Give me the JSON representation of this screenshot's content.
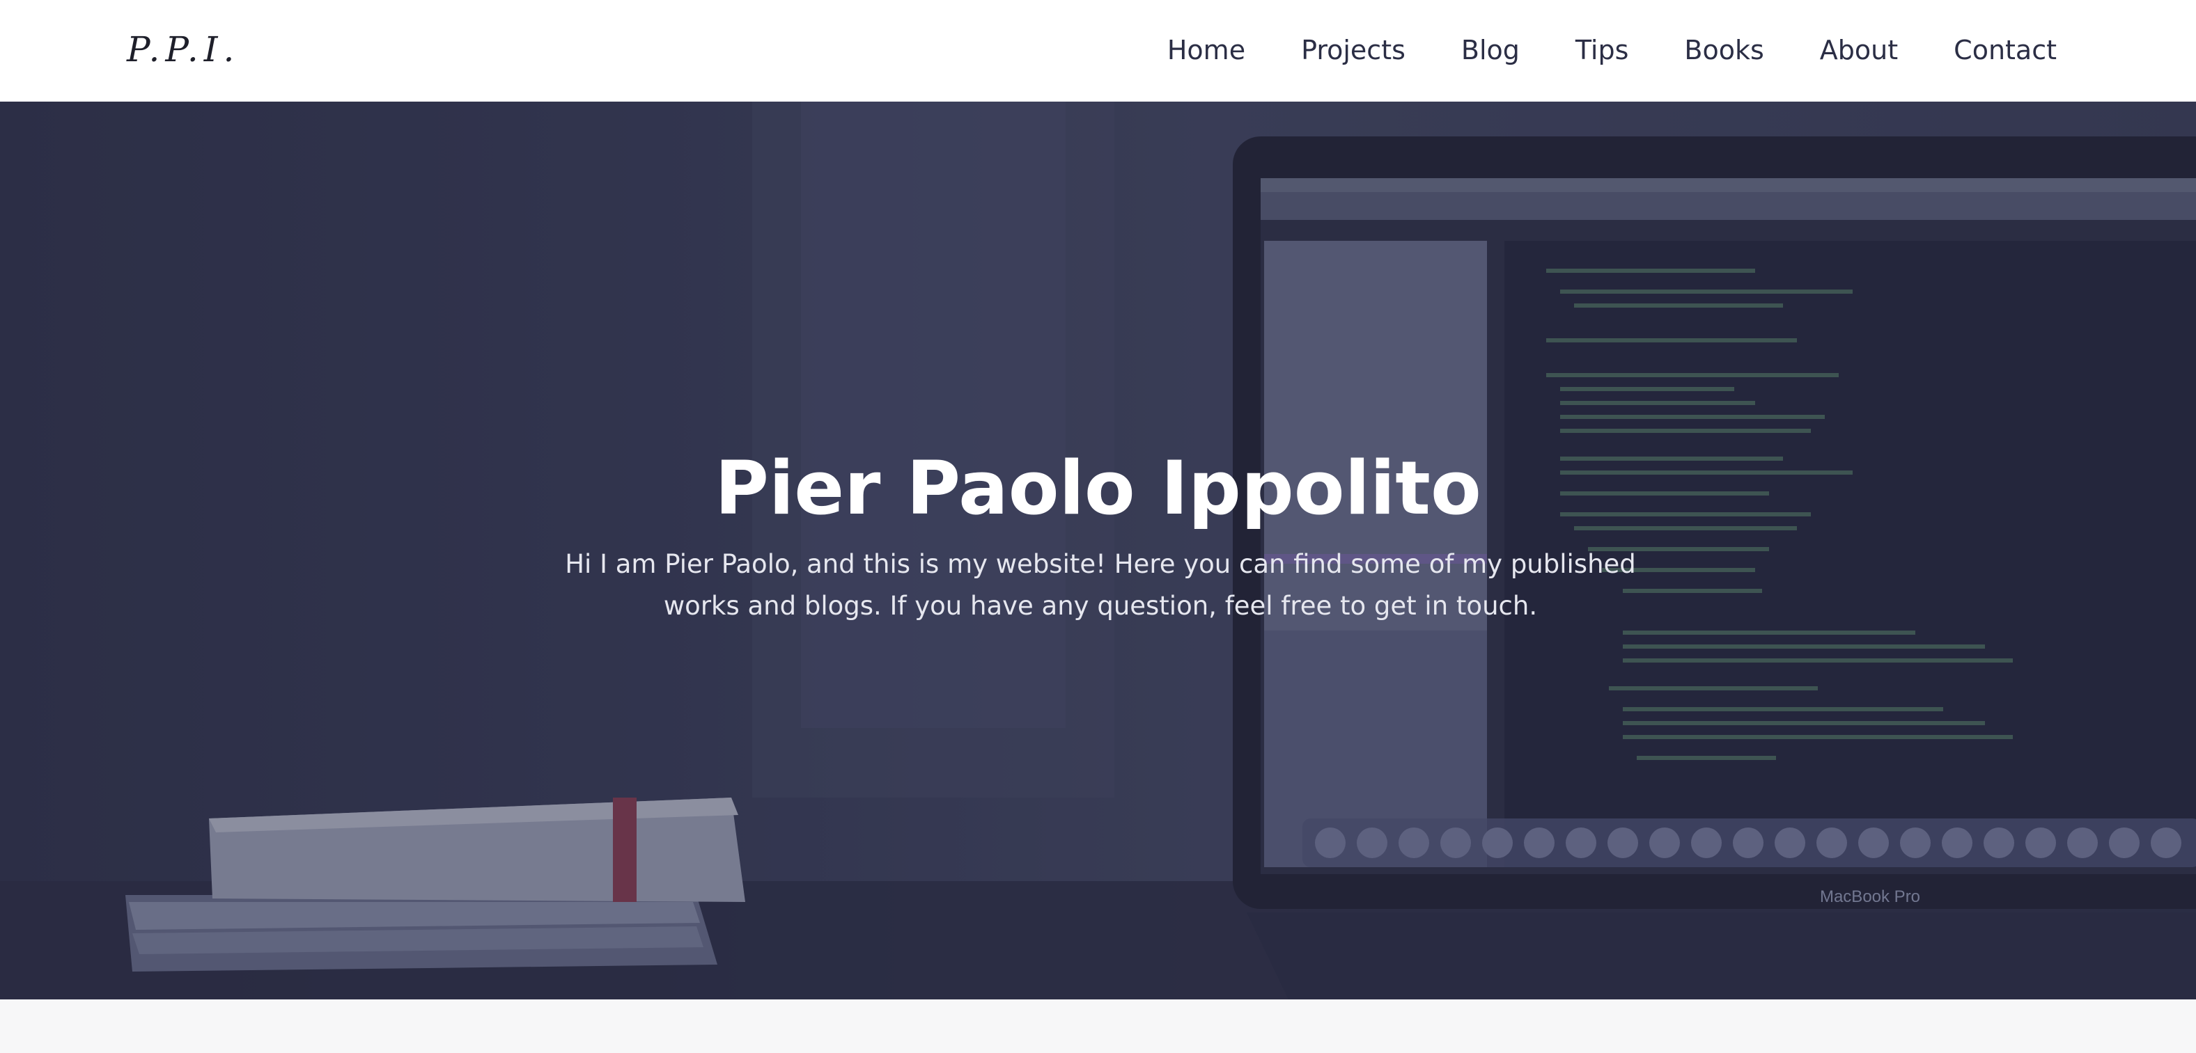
{
  "site": {
    "logo": "P.P.I."
  },
  "nav": {
    "items": [
      {
        "label": "Home"
      },
      {
        "label": "Projects"
      },
      {
        "label": "Blog"
      },
      {
        "label": "Tips"
      },
      {
        "label": "Books"
      },
      {
        "label": "About"
      },
      {
        "label": "Contact"
      }
    ]
  },
  "hero": {
    "title": "Pier Paolo Ippolito",
    "description": "Hi I am Pier Paolo, and this is my website! Here you can find some of my published works and blogs. If you have any question, feel free to get in touch.",
    "laptop_label": "MacBook Pro"
  },
  "colors": {
    "header_bg": "#ffffff",
    "nav_text": "#2b2e45",
    "hero_overlay": "#2f3149",
    "hero_title": "#ffffff",
    "hero_text": "#e6e7ef",
    "page_bg": "#f7f7f8"
  }
}
